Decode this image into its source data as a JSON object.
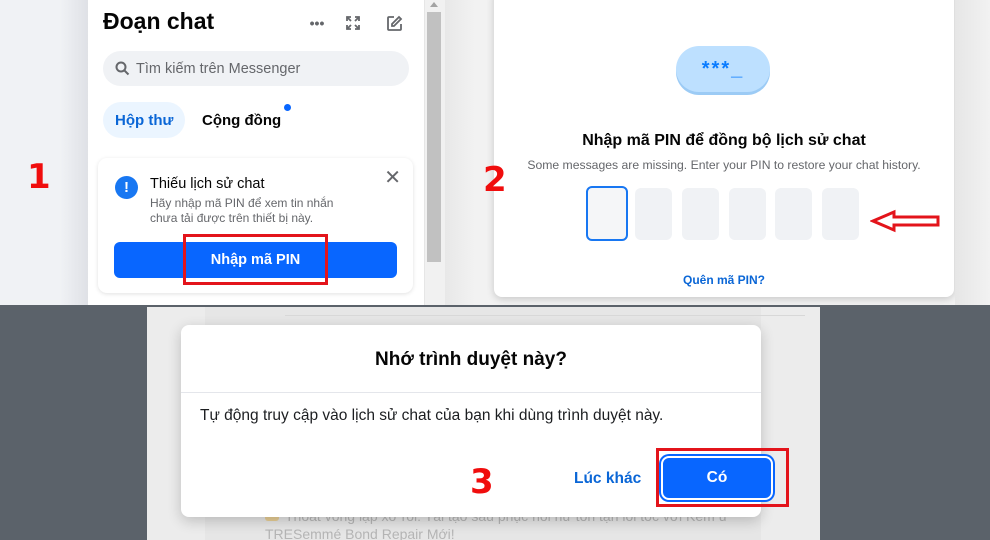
{
  "panel1": {
    "step_number": "1",
    "title": "Đoạn chat",
    "header_icons": [
      "more-options-icon",
      "expand-icon",
      "new-message-icon"
    ],
    "search_placeholder": "Tìm kiếm trên Messenger",
    "tabs": [
      {
        "label": "Hộp thư",
        "active": true
      },
      {
        "label": "Cộng đồng",
        "active": false,
        "has_dot": true
      }
    ],
    "notice": {
      "title": "Thiếu lịch sử chat",
      "body": "Hãy nhập mã PIN để xem tin nhắn chưa tải được trên thiết bị này.",
      "button_label": "Nhập mã PIN",
      "icon": "!"
    }
  },
  "panel2": {
    "step_number": "2",
    "pin_bubble": "***_",
    "title": "Nhập mã PIN để đồng bộ lịch sử chat",
    "subtitle": "Some messages are missing. Enter your PIN to restore your chat history.",
    "pin_digits": [
      "",
      "",
      "",
      "",
      "",
      ""
    ],
    "forgot_link": "Quên mã PIN?"
  },
  "panel3": {
    "step_number": "3",
    "dialog_title": "Nhớ trình duyệt này?",
    "dialog_body": "Tự động truy cập vào lịch sử chat của bạn khi dùng trình duyệt này.",
    "later_button": "Lúc khác",
    "yes_button": "Có",
    "background_feed_text": "Thoát vòng lặp xơ rối: Tái tạo sâu phục hồi hư tổn tận lõi tóc với Kem ủ TRESemmé Bond Repair Mới!"
  },
  "colors": {
    "accent": "#0866ff",
    "link": "#0a66d6",
    "annotation_red": "#e3141b",
    "backdrop": "#5b626a"
  }
}
